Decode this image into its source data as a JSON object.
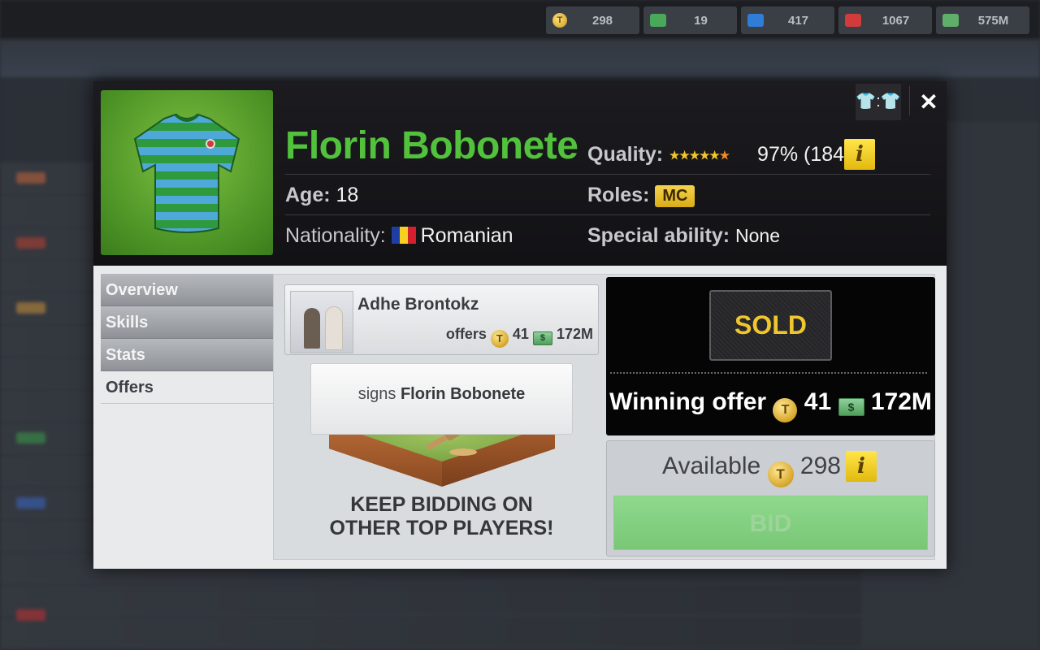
{
  "resources": [
    {
      "icon": "coin-icon",
      "value": "298"
    },
    {
      "icon": "green-token-icon",
      "value": "19"
    },
    {
      "icon": "energy-icon",
      "value": "417"
    },
    {
      "icon": "medical-icon",
      "value": "1067"
    },
    {
      "icon": "cash-icon",
      "value": "575M"
    }
  ],
  "player": {
    "name": "Florin Bobonete",
    "age_label": "Age:",
    "age": "18",
    "nationality_label": "Nationality:",
    "nationality": "Romanian",
    "quality_label": "Quality:",
    "quality_value": "97% (184)",
    "quality_stars": "★★★★★",
    "quality_half_star": "★",
    "roles_label": "Roles:",
    "role": "MC",
    "special_label": "Special ability:",
    "special": "None"
  },
  "header_controls": {
    "compare_label": "👕:👕",
    "close_label": "✕",
    "info_label": "i"
  },
  "tabs": [
    {
      "label": "Overview",
      "active": false
    },
    {
      "label": "Skills",
      "active": false
    },
    {
      "label": "Stats",
      "active": false
    },
    {
      "label": "Offers",
      "active": true
    }
  ],
  "offers": {
    "bidder_name": "Adhe Brontokz",
    "offers_label": "offers",
    "coins": "41",
    "cash": "172M",
    "signs_prefix": "signs",
    "signs_name": "Florin Bobonete",
    "keep_line1": "KEEP BIDDING ON",
    "keep_line2": "OTHER TOP PLAYERS!"
  },
  "result": {
    "status": "SOLD",
    "winning_label": "Winning offer",
    "winning_coins": "41",
    "winning_cash": "172M"
  },
  "available": {
    "label": "Available",
    "value": "298",
    "bid_label": "BID"
  },
  "icons": {
    "coin_glyph": "T",
    "cash_glyph": "$"
  }
}
